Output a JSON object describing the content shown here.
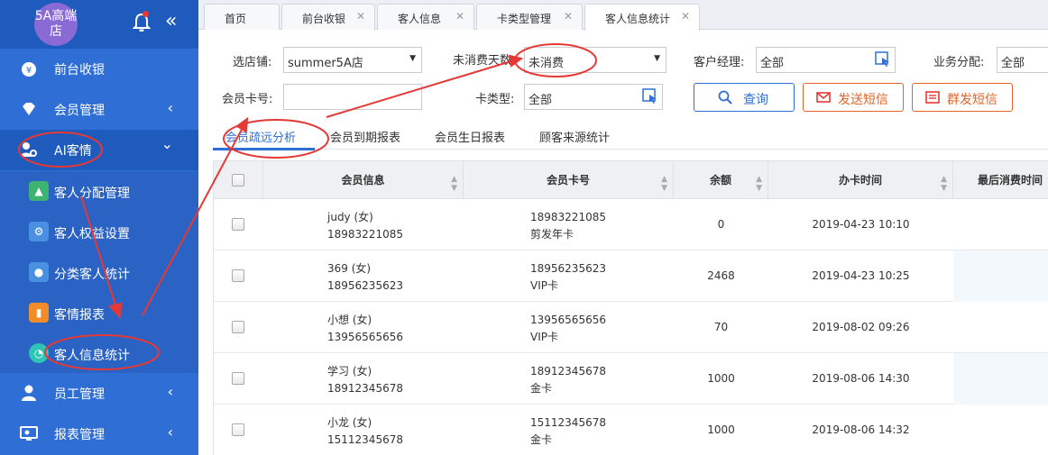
{
  "store": {
    "logo_text": "5A高端店"
  },
  "colors": {
    "sidebar": "#2f6ed4",
    "sidebar_dark": "#1f5bbd",
    "accent_blue": "#2f6ed4",
    "annotation_red": "#e53935",
    "orange_btn": "#e0662a"
  },
  "sidebar": {
    "collapse_glyph": "«",
    "menu": [
      {
        "label": "前台收银",
        "icon": "money-bag-icon",
        "arrow": ""
      },
      {
        "label": "会员管理",
        "icon": "diamond-icon",
        "arrow": "‹"
      },
      {
        "label": "AI客情",
        "icon": "users-gear-icon",
        "arrow": "⌄"
      },
      {
        "label": "员工管理",
        "icon": "person-icon",
        "arrow": "‹"
      },
      {
        "label": "报表管理",
        "icon": "monitor-icon",
        "arrow": "‹"
      }
    ],
    "submenu": [
      {
        "label": "客人分配管理",
        "icon": "person-card-icon"
      },
      {
        "label": "客人权益设置",
        "icon": "gear-icon"
      },
      {
        "label": "分类客人统计",
        "icon": "group-icon"
      },
      {
        "label": "客情报表",
        "icon": "bar-chart-icon"
      },
      {
        "label": "客人信息统计",
        "icon": "pie-chart-icon"
      }
    ]
  },
  "tabs": [
    {
      "label": "首页"
    },
    {
      "label": "前台收银"
    },
    {
      "label": "客人信息"
    },
    {
      "label": "卡类型管理"
    },
    {
      "label": "客人信息统计"
    }
  ],
  "filters": {
    "store_label": "选店铺:",
    "store_value": "summer5A店",
    "days_label": "未消费天数",
    "days_value": "未消费",
    "manager_label": "客户经理:",
    "manager_value": "全部",
    "assign_label": "业务分配:",
    "assign_value": "全部",
    "card_no_label": "会员卡号:",
    "card_no_value": "",
    "card_type_label": "卡类型:",
    "card_type_value": "全部"
  },
  "buttons": {
    "query": "查询",
    "send_sms": "发送短信",
    "group_sms": "群发短信"
  },
  "subtabs": [
    "会员疏远分析",
    "会员到期报表",
    "会员生日报表",
    "顾客来源统计"
  ],
  "table": {
    "headers": [
      "会员信息",
      "会员卡号",
      "余额",
      "办卡时间",
      "最后消费时间"
    ],
    "rows": [
      {
        "name": "judy (女)",
        "phone": "18983221085",
        "card_no": "18983221085",
        "card_type": "剪发年卡",
        "balance": "0",
        "opened": "2019-04-23 10:10"
      },
      {
        "name": "369 (女)",
        "phone": "18956235623",
        "card_no": "18956235623",
        "card_type": "VIP卡",
        "balance": "2468",
        "opened": "2019-04-23 10:25"
      },
      {
        "name": "小想 (女)",
        "phone": "13956565656",
        "card_no": "13956565656",
        "card_type": "VIP卡",
        "balance": "70",
        "opened": "2019-08-02 09:26"
      },
      {
        "name": "学习 (女)",
        "phone": "18912345678",
        "card_no": "18912345678",
        "card_type": "金卡",
        "balance": "1000",
        "opened": "2019-08-06 14:30"
      },
      {
        "name": "小龙 (女)",
        "phone": "15112345678",
        "card_no": "15112345678",
        "card_type": "金卡",
        "balance": "1000",
        "opened": "2019-08-06 14:32"
      }
    ]
  }
}
